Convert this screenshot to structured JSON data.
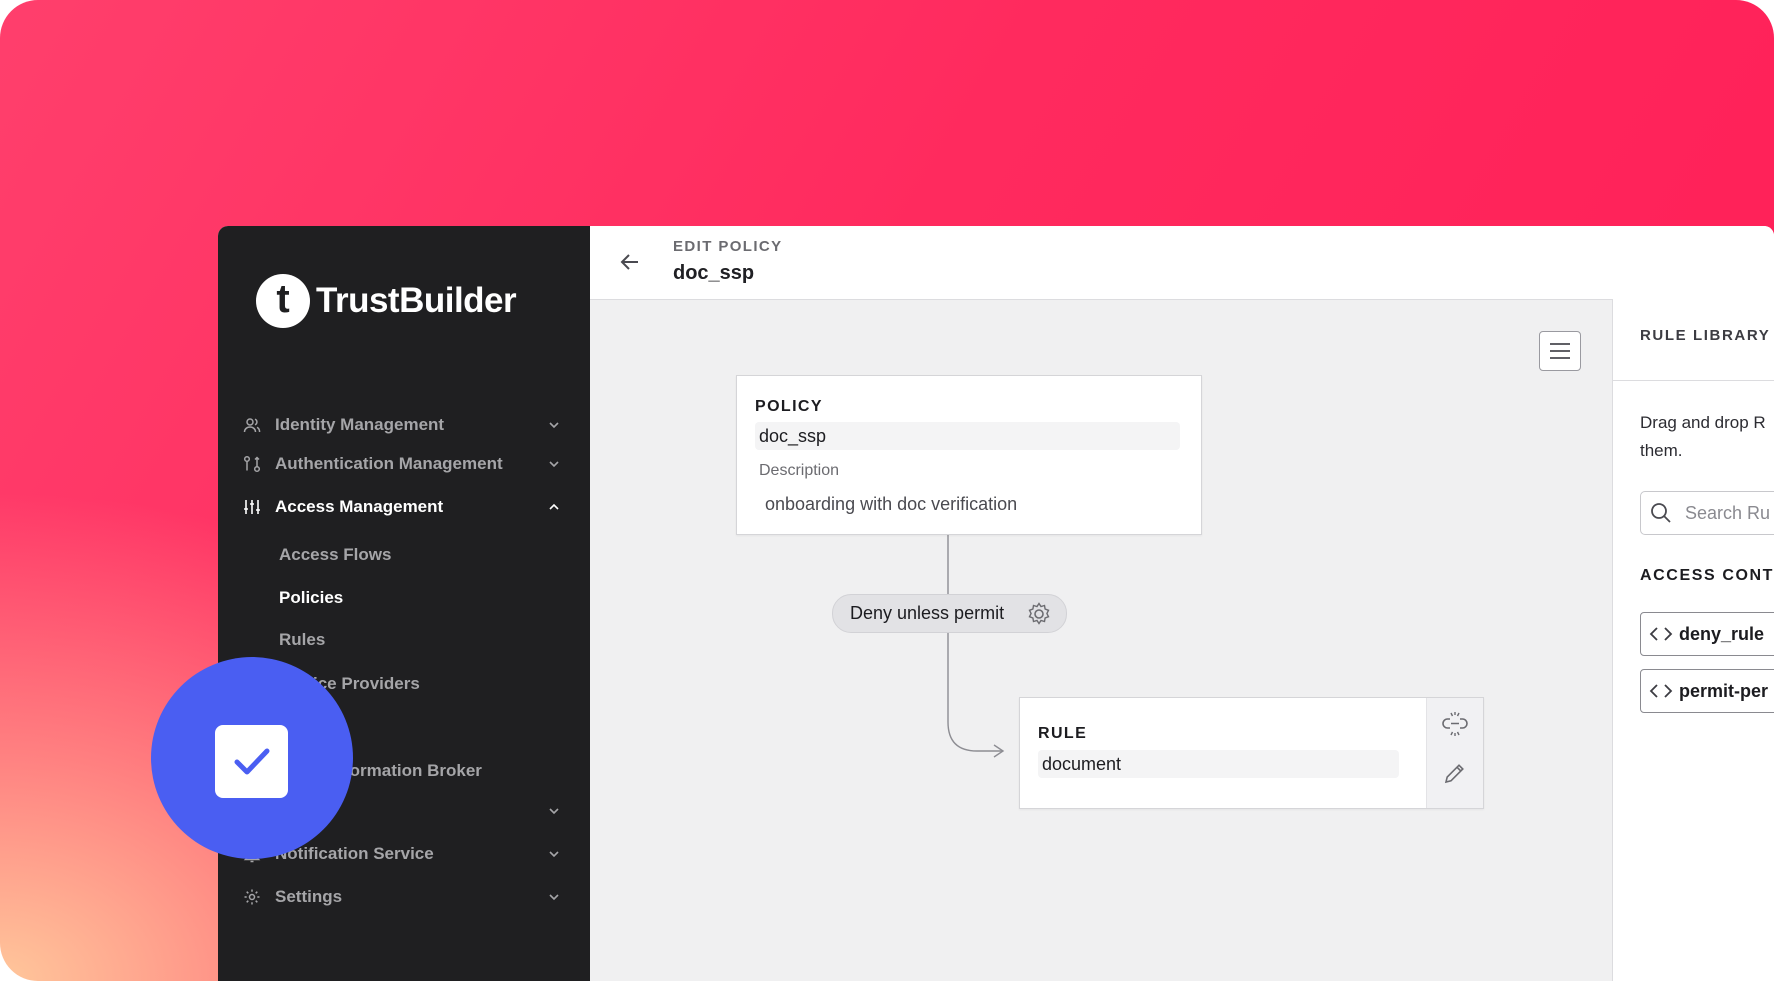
{
  "brand": {
    "name": "TrustBuilder",
    "mark": "t"
  },
  "sidebar": {
    "items": [
      {
        "label": "Identity Management",
        "icon": "users-icon"
      },
      {
        "label": "Authentication Management",
        "icon": "auth-flow-icon"
      },
      {
        "label": "Access Management",
        "icon": "sliders-icon",
        "expanded": true
      },
      {
        "label": "Notification Service",
        "icon": "bell-icon"
      },
      {
        "label": "Settings",
        "icon": "gear-icon"
      }
    ],
    "subitems": [
      {
        "label": "Access Flows"
      },
      {
        "label": "Policies",
        "active": true
      },
      {
        "label": "Rules"
      },
      {
        "label": "ice Providers"
      },
      {
        "label": "formation Broker"
      },
      {
        "label": "s"
      }
    ]
  },
  "header": {
    "eyebrow": "EDIT POLICY",
    "title": "doc_ssp"
  },
  "policy_card": {
    "label": "POLICY",
    "name": "doc_ssp",
    "description_label": "Description",
    "description": "onboarding with doc verification"
  },
  "combiner": {
    "label": "Deny unless permit"
  },
  "rule_card": {
    "label": "RULE",
    "name": "document"
  },
  "rule_library": {
    "title": "RULE LIBRARY",
    "help_line1": "Drag and drop R",
    "help_line2": "them.",
    "search_placeholder": "Search Ru",
    "section": "ACCESS CONT",
    "rules": [
      {
        "label": "deny_rule"
      },
      {
        "label": "permit-per"
      }
    ]
  },
  "colors": {
    "accent": "#4a5ef2",
    "sidebar_bg": "#1f1f21",
    "backdrop": "#ff2a5e"
  }
}
